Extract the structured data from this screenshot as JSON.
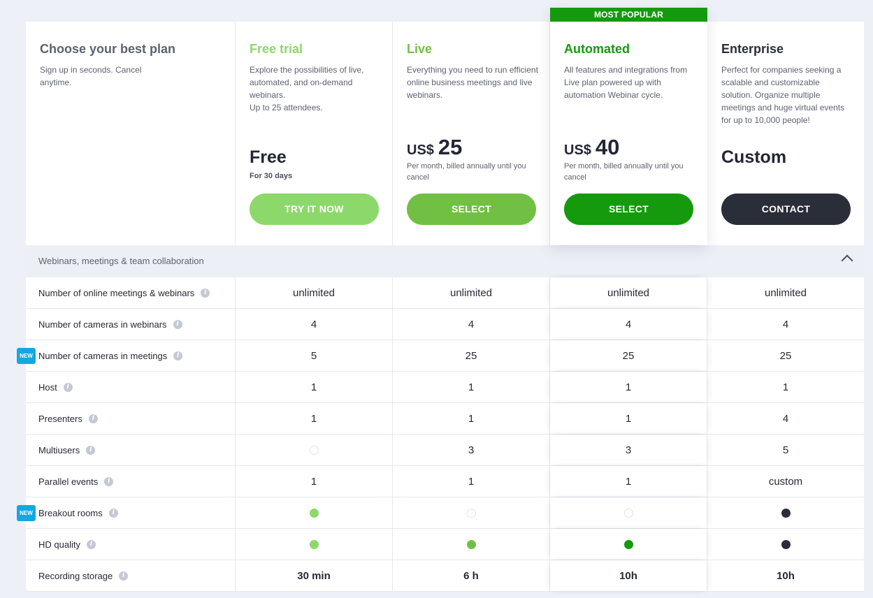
{
  "intro": {
    "title": "Choose your best plan",
    "subtitle": "Sign up in seconds. Cancel anytime."
  },
  "plans": [
    {
      "name": "Free trial",
      "color": "#8dd86a",
      "description": "Explore the possibilities of live, automated, and on-demand webinars.\nUp to 25 attendees.",
      "price_label": "Free",
      "price_note": "For 30 days",
      "button": "TRY IT NOW"
    },
    {
      "name": "Live",
      "color": "#72c043",
      "description": "Everything you need to run efficient online business meetings and live webinars.",
      "currency": "US$",
      "price": "25",
      "price_note": "Per month, billed annually until you cancel",
      "button": "SELECT"
    },
    {
      "name": "Automated",
      "color": "#159a0e",
      "badge": "MOST POPULAR",
      "description": "All features and integrations from Live plan powered up with automation Webinar cycle.",
      "currency": "US$",
      "price": "40",
      "price_note": "Per month, billed annually until you cancel",
      "button": "SELECT"
    },
    {
      "name": "Enterprise",
      "color": "#2a2e38",
      "description": "Perfect for companies seeking a scalable and customizable solution. Organize multiple meetings and huge virtual events for up to 10,000 people!",
      "price_label": "Custom",
      "button": "CONTACT"
    }
  ],
  "section": {
    "title": "Webinars, meetings & team collaboration"
  },
  "new_badge": "NEW",
  "features": [
    {
      "label": "Number of online meetings & webinars",
      "new": false,
      "values": [
        "unlimited",
        "unlimited",
        "unlimited",
        "unlimited"
      ]
    },
    {
      "label": "Number of cameras in webinars",
      "new": false,
      "values": [
        "4",
        "4",
        "4",
        "4"
      ]
    },
    {
      "label": "Number of cameras in meetings",
      "new": true,
      "values": [
        "5",
        "25",
        "25",
        "25"
      ]
    },
    {
      "label": "Host",
      "new": false,
      "values": [
        "1",
        "1",
        "1",
        "1"
      ]
    },
    {
      "label": "Presenters",
      "new": false,
      "values": [
        "1",
        "1",
        "1",
        "4"
      ]
    },
    {
      "label": "Multiusers",
      "new": false,
      "values": [
        {
          "dot": "empty"
        },
        "3",
        "3",
        "5"
      ]
    },
    {
      "label": "Parallel events",
      "new": false,
      "values": [
        "1",
        "1",
        "1",
        "custom"
      ]
    },
    {
      "label": "Breakout rooms",
      "new": true,
      "values": [
        {
          "dot": "filled"
        },
        {
          "dot": "empty"
        },
        {
          "dot": "empty"
        },
        {
          "dot": "filled"
        }
      ]
    },
    {
      "label": "HD quality",
      "new": false,
      "values": [
        {
          "dot": "filled"
        },
        {
          "dot": "filled"
        },
        {
          "dot": "filled"
        },
        {
          "dot": "filled"
        }
      ]
    },
    {
      "label": "Recording storage",
      "new": false,
      "bold": true,
      "values": [
        "30 min",
        "6 h",
        "10h",
        "10h"
      ]
    }
  ]
}
